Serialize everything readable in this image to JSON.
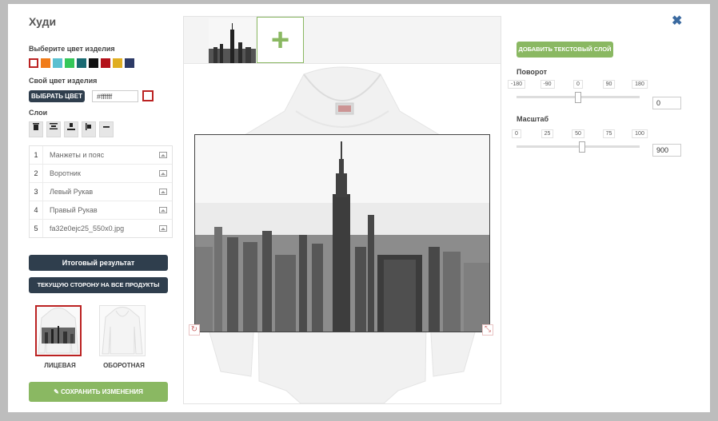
{
  "dialog": {
    "title": "Худи",
    "close_glyph": "✖"
  },
  "color": {
    "label": "Выберите цвет изделия",
    "swatches": [
      "#ffffff",
      "#f07c1a",
      "#5ac0d0",
      "#34c759",
      "#1a6a72",
      "#111111",
      "#b3121a",
      "#e0ae22",
      "#2d3a66"
    ],
    "selected": "#ffffff"
  },
  "custom_color": {
    "label": "Свой цвет изделия",
    "button": "ВЫБРАТЬ ЦВЕТ",
    "value": "#ffffff"
  },
  "layers": {
    "label": "Слои",
    "tools": [
      "trash-icon",
      "align-top-icon",
      "align-bottom-icon",
      "align-left-icon",
      "minus-icon"
    ],
    "items": [
      {
        "num": "1",
        "name": "Манжеты и пояс"
      },
      {
        "num": "2",
        "name": "Воротник"
      },
      {
        "num": "3",
        "name": "Левый Рукав"
      },
      {
        "num": "4",
        "name": "Правый Рукав"
      },
      {
        "num": "5",
        "name": "fa32e0ejc25_550x0.jpg"
      }
    ]
  },
  "actions": {
    "result": "Итоговый результат",
    "apply_all": "ТЕКУЩУЮ СТОРОНУ НА ВСЕ ПРОДУКТЫ",
    "save": "СОХРАНИТЬ ИЗМЕНЕНИЯ",
    "save_icon": "✎"
  },
  "sides": {
    "front": "ЛИЦЕВАЯ",
    "back": "ОБОРОТНАЯ",
    "selected": "front"
  },
  "right_panel": {
    "add_text": "ДОБАВИТЬ ТЕКСТОВЫЙ СЛОЙ",
    "rotation": {
      "label": "Поворот",
      "ticks": [
        "-180",
        "-90",
        "0",
        "90",
        "180"
      ],
      "value": "0",
      "level": 0.5
    },
    "scale": {
      "label": "Масштаб",
      "ticks": [
        "0",
        "25",
        "50",
        "75",
        "100"
      ],
      "value": "900",
      "level": 0.5
    }
  },
  "canvas": {
    "add_glyph": "+",
    "rotate_glyph": "↻",
    "resize_glyph": "⤡"
  }
}
